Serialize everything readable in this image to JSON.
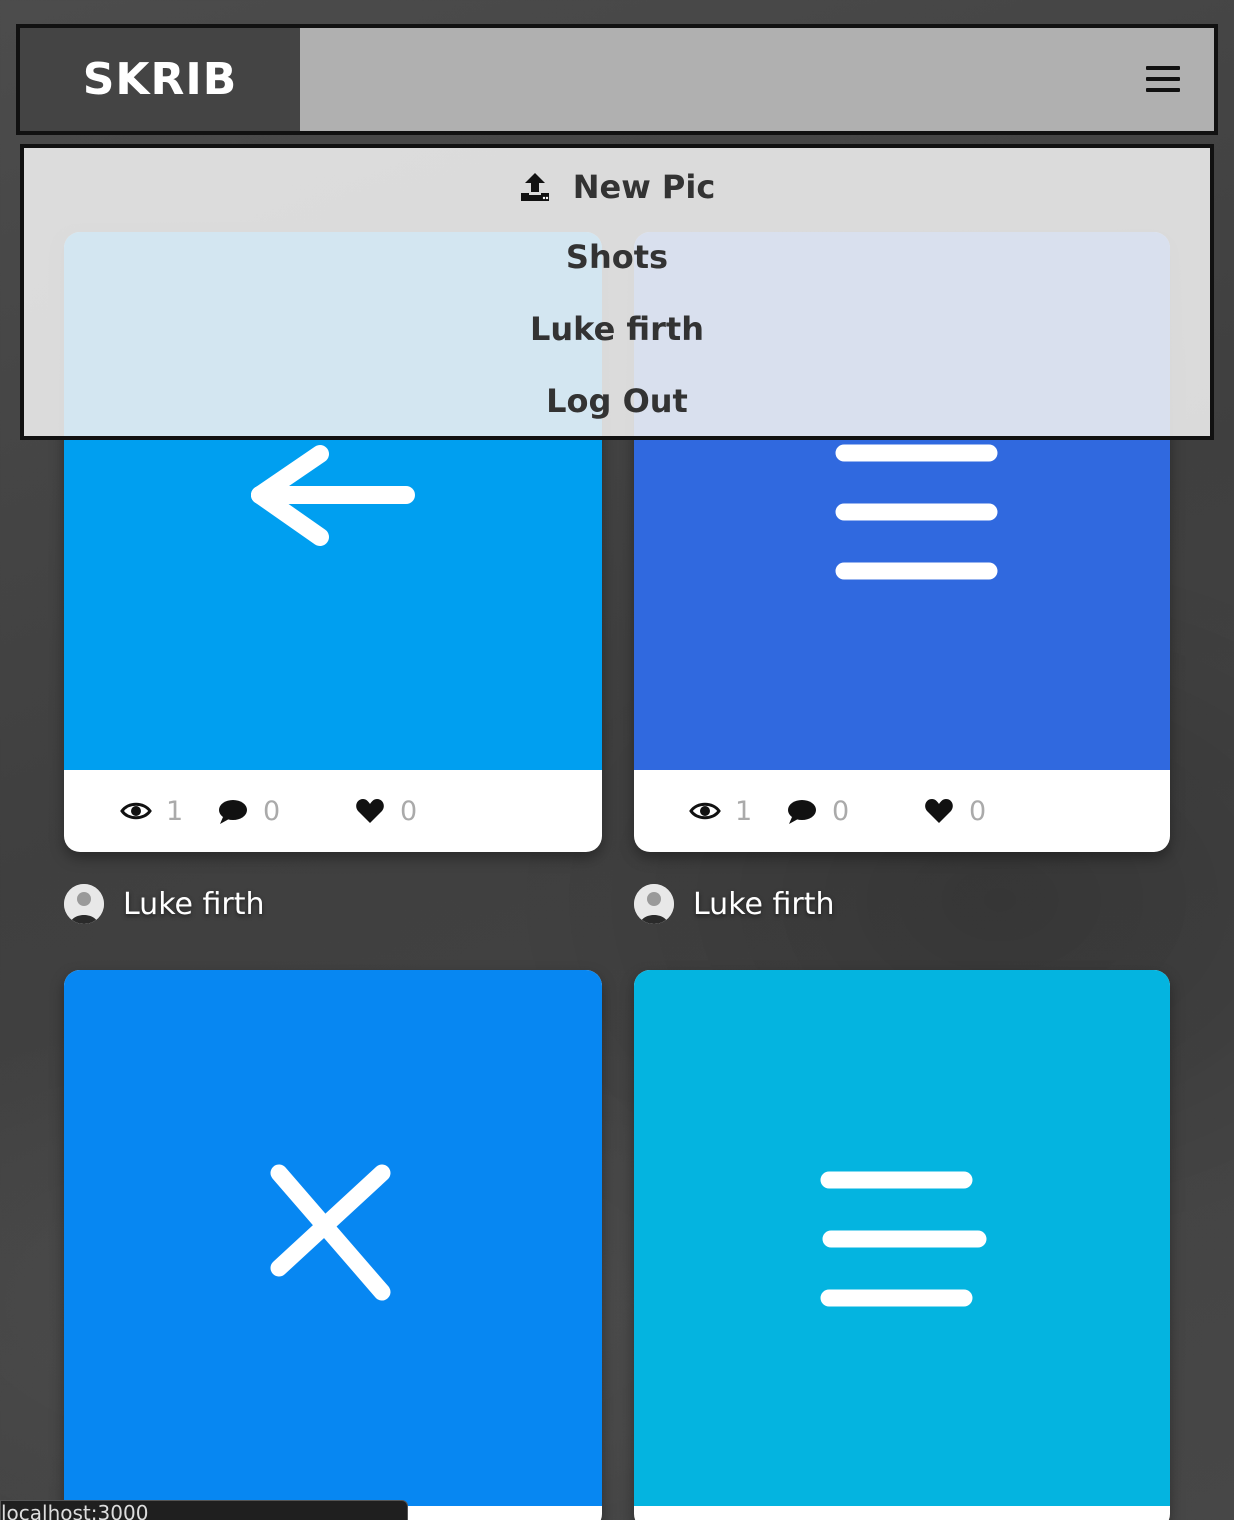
{
  "header": {
    "logo": "SKRIB"
  },
  "menu": {
    "items": [
      {
        "label": "New Pic"
      },
      {
        "label": "Shots"
      },
      {
        "label": "Luke firth"
      },
      {
        "label": "Log Out"
      }
    ]
  },
  "cards": [
    {
      "views": "1",
      "comments": "0",
      "likes": "0",
      "author": "Luke firth",
      "color": "#009ff0",
      "icon": "arrow-left-icon"
    },
    {
      "views": "1",
      "comments": "0",
      "likes": "0",
      "author": "Luke firth",
      "color": "#3069df",
      "icon": "menu-lines-icon"
    },
    {
      "color": "#0787f2",
      "icon": "close-x-icon"
    },
    {
      "color": "#04b4e0",
      "icon": "menu-lines-icon"
    }
  ],
  "status_bar": {
    "url": "localhost:3000"
  }
}
